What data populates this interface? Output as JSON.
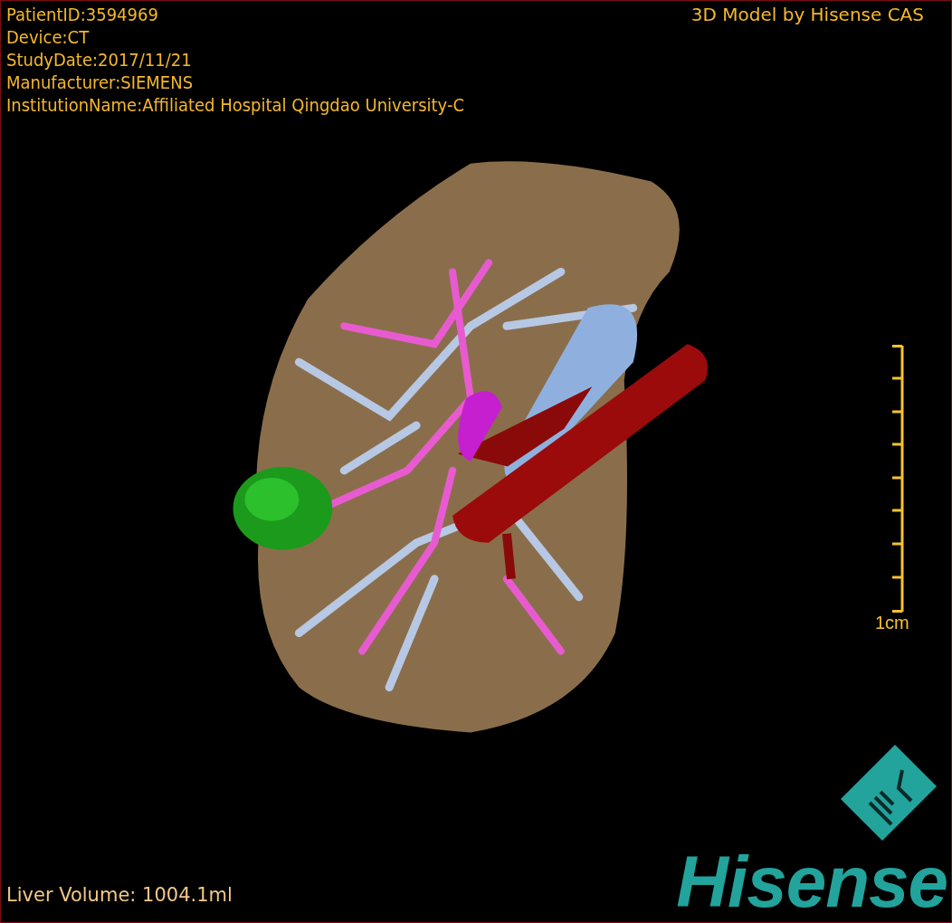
{
  "study_info": [
    "PatientID:3594969",
    "Device:CT",
    "StudyDate:2017/11/21",
    "Manufacturer:SIEMENS",
    "InstitutionName:Affiliated Hospital Qingdao University-C"
  ],
  "model_credit": "3D Model by Hisense CAS",
  "scale_bar": {
    "label": "1cm"
  },
  "volume_label": "Liver Volume: 1004.1ml",
  "logo": {
    "text": "Hisense"
  }
}
